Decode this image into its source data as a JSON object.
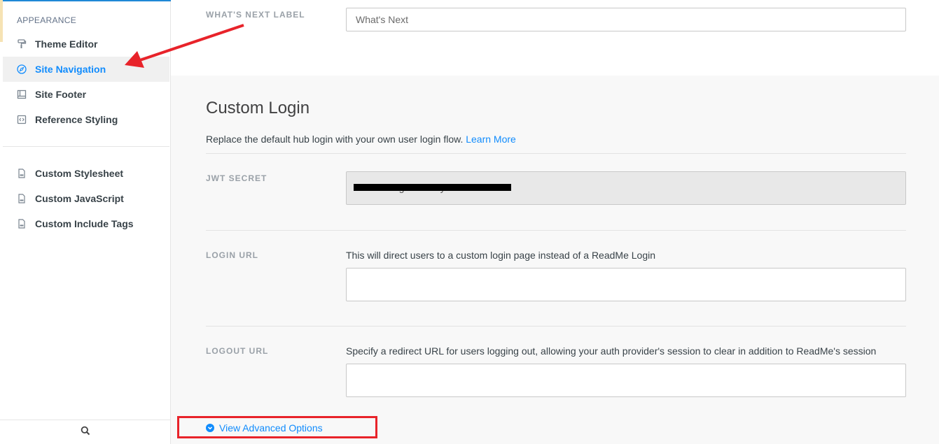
{
  "sidebar": {
    "section_label": "APPEARANCE",
    "items": [
      {
        "label": "Theme Editor",
        "icon": "paint-roller-icon",
        "active": false
      },
      {
        "label": "Site Navigation",
        "icon": "compass-icon",
        "active": true
      },
      {
        "label": "Site Footer",
        "icon": "layout-footer-icon",
        "active": false
      },
      {
        "label": "Reference Styling",
        "icon": "code-icon",
        "active": false
      }
    ],
    "custom_items": [
      {
        "label": "Custom Stylesheet",
        "icon": "file-css-icon"
      },
      {
        "label": "Custom JavaScript",
        "icon": "file-js-icon"
      },
      {
        "label": "Custom Include Tags",
        "icon": "file-html-icon"
      }
    ],
    "bottom_icon": "search-icon"
  },
  "whats_next": {
    "label": "WHAT'S NEXT LABEL",
    "value": "What's Next"
  },
  "custom_login": {
    "title": "Custom Login",
    "description": "Replace the default hub login with your own user login flow.",
    "learn_more": "Learn More",
    "jwt": {
      "label": "JWT SECRET",
      "value": "7kB6cDZg6CmsJ9y2Y"
    },
    "login_url": {
      "label": "LOGIN URL",
      "help": "This will direct users to a custom login page instead of a ReadMe Login",
      "value": ""
    },
    "logout_url": {
      "label": "LOGOUT URL",
      "help": "Specify a redirect URL for users logging out, allowing your auth provider's session to clear in addition to ReadMe's session",
      "value": ""
    }
  },
  "advanced": {
    "label": "View Advanced Options"
  },
  "colors": {
    "accent": "#118cfd",
    "annotation": "#e8232a"
  }
}
